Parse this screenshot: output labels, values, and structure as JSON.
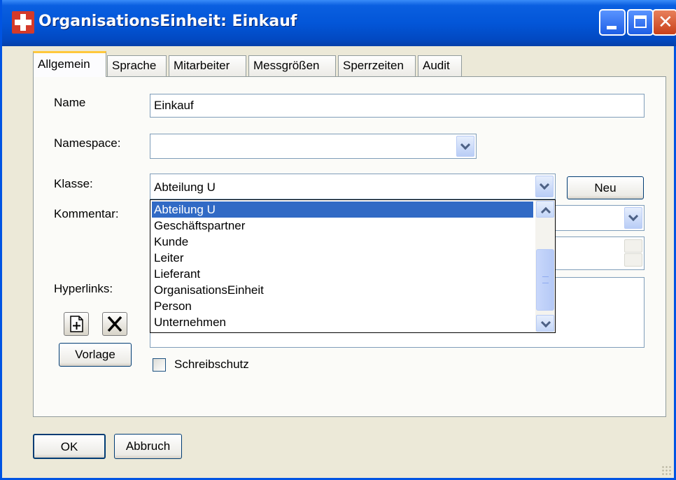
{
  "window": {
    "title": "OrganisationsEinheit: Einkauf",
    "close_glyph": "✕"
  },
  "tabs": [
    {
      "label": "Allgemein",
      "active": true
    },
    {
      "label": "Sprache",
      "active": false
    },
    {
      "label": "Mitarbeiter",
      "active": false
    },
    {
      "label": "Messgrößen",
      "active": false
    },
    {
      "label": "Sperrzeiten",
      "active": false
    },
    {
      "label": "Audit",
      "active": false
    }
  ],
  "form": {
    "name_label": "Name",
    "name_value": "Einkauf",
    "namespace_label": "Namespace:",
    "namespace_value": "",
    "klasse_label": "Klasse:",
    "klasse_value": "Abteilung U",
    "neu_label": "Neu",
    "kommentar_label": "Kommentar:",
    "hyperlinks_label": "Hyperlinks:",
    "vorlage_label": "Vorlage",
    "schreibschutz_label": "Schreibschutz",
    "schreibschutz_checked": false
  },
  "klasse_dropdown": {
    "options": [
      "Abteilung U",
      "Geschäftspartner",
      "Kunde",
      "Leiter",
      "Lieferant",
      "OrganisationsEinheit",
      "Person",
      "Unternehmen"
    ],
    "selected_index": 0
  },
  "footer": {
    "ok_label": "OK",
    "cancel_label": "Abbruch"
  },
  "colors": {
    "titlebar": "#0356d8",
    "selection": "#316ac5",
    "active_tab_accent": "#ffc83c"
  }
}
